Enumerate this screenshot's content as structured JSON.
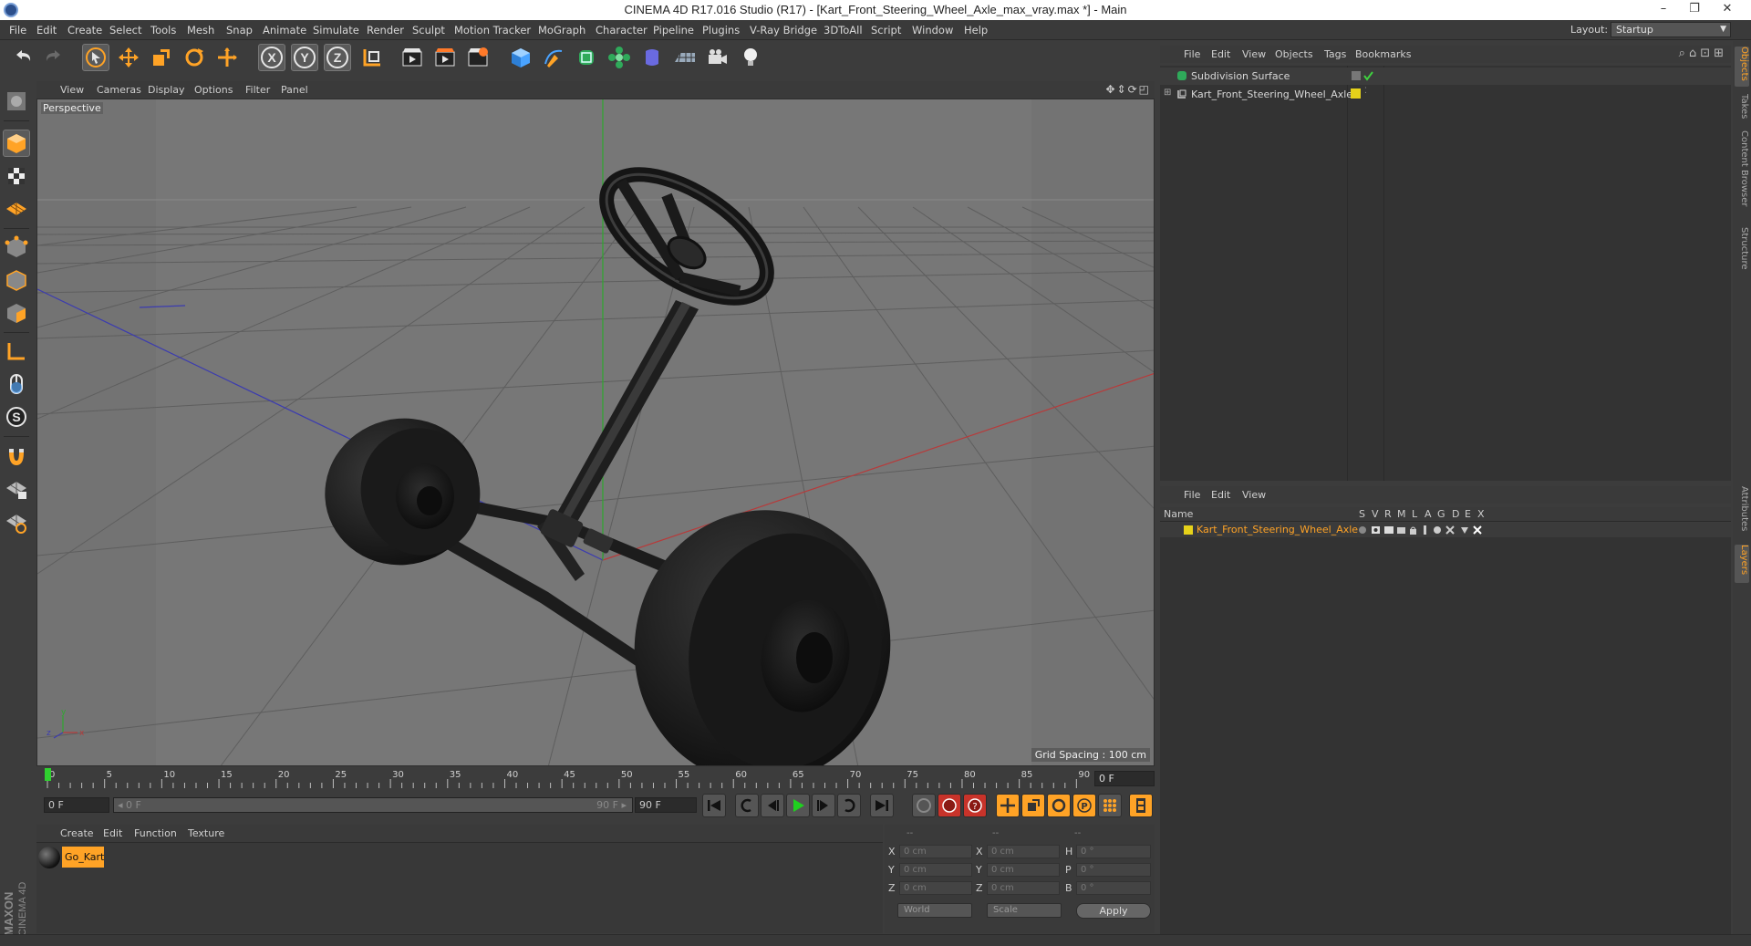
{
  "window": {
    "title": "CINEMA 4D R17.016 Studio (R17) - [Kart_Front_Steering_Wheel_Axle_max_vray.max *] - Main",
    "minimize": "–",
    "restore": "❐",
    "close": "✕"
  },
  "menubar": {
    "items": [
      "File",
      "Edit",
      "Create",
      "Select",
      "Tools",
      "Mesh",
      "Snap",
      "Animate",
      "Simulate",
      "Render",
      "Sculpt",
      "Motion Tracker",
      "MoGraph",
      "Character",
      "Pipeline",
      "Plugins",
      "V-Ray Bridge",
      "3DToAll",
      "Script",
      "Window",
      "Help"
    ],
    "layout_label": "Layout:",
    "layout_value": "Startup"
  },
  "toolbar": {
    "icons": [
      "undo-icon",
      "redo-icon",
      "live-selection-icon",
      "move-icon",
      "scale-icon",
      "rotate-icon",
      "last-tool-icon",
      "x-axis-icon",
      "y-axis-icon",
      "z-axis-icon",
      "coordinate-system-icon",
      "render-view-icon",
      "render-picture-viewer-icon",
      "edit-render-settings-icon",
      "cube-icon",
      "pen-icon",
      "subdivision-icon",
      "mograph-icon",
      "deformer-icon",
      "floor-icon",
      "camera-icon",
      "light-icon"
    ],
    "x_label": "X",
    "y_label": "Y",
    "z_label": "Z"
  },
  "viewport": {
    "menus": [
      "View",
      "Cameras",
      "Display",
      "Options",
      "Filter",
      "Panel"
    ],
    "nav_icons": "✥⇕⟳◰",
    "label": "Perspective",
    "grid_spacing": "Grid Spacing : 100 cm",
    "axis_x": "x",
    "axis_y": "y",
    "axis_z": "z"
  },
  "timeline": {
    "ticks": [
      "0",
      "5",
      "10",
      "15",
      "20",
      "25",
      "30",
      "35",
      "40",
      "45",
      "50",
      "55",
      "60",
      "65",
      "70",
      "75",
      "80",
      "85",
      "90"
    ],
    "current_frame": "0 F"
  },
  "transport": {
    "start_field": "0 F",
    "slider_left": "◂ 0 F",
    "slider_right": "90 F ▸",
    "end_field": "90 F"
  },
  "material_manager": {
    "menus": [
      "Create",
      "Edit",
      "Function",
      "Texture"
    ],
    "material_name": "Go_Kart"
  },
  "coordinates": {
    "headers": [
      "--",
      "--",
      "--"
    ],
    "rows": [
      {
        "a": "X",
        "pos": "0 cm",
        "b": "X",
        "size": "0 cm",
        "c": "H",
        "rot": "0 °"
      },
      {
        "a": "Y",
        "pos": "0 cm",
        "b": "Y",
        "size": "0 cm",
        "c": "P",
        "rot": "0 °"
      },
      {
        "a": "Z",
        "pos": "0 cm",
        "b": "Z",
        "size": "0 cm",
        "c": "B",
        "rot": "0 °"
      }
    ],
    "mode_world": "World",
    "mode_scale": "Scale",
    "apply": "Apply"
  },
  "object_manager": {
    "menus": [
      "File",
      "Edit",
      "View",
      "Objects",
      "Tags",
      "Bookmarks"
    ],
    "objects": [
      {
        "name": "Subdivision Surface"
      },
      {
        "name": "Kart_Front_Steering_Wheel_Axle"
      }
    ]
  },
  "layer_manager": {
    "menus": [
      "File",
      "Edit",
      "View"
    ],
    "columns": [
      "Name",
      "S",
      "V",
      "R",
      "M",
      "L",
      "A",
      "G",
      "D",
      "E",
      "X"
    ],
    "layer_name": "Kart_Front_Steering_Wheel_Axle"
  },
  "right_tabs": [
    "Objects",
    "Takes",
    "Content Browser",
    "Structure",
    "Attributes",
    "Layers"
  ],
  "logo": {
    "brand": "MAXON",
    "product": "CINEMA 4D"
  },
  "colors": {
    "accent": "#ffa326",
    "viewport_bg": "#737373",
    "panel_bg": "#333333"
  }
}
